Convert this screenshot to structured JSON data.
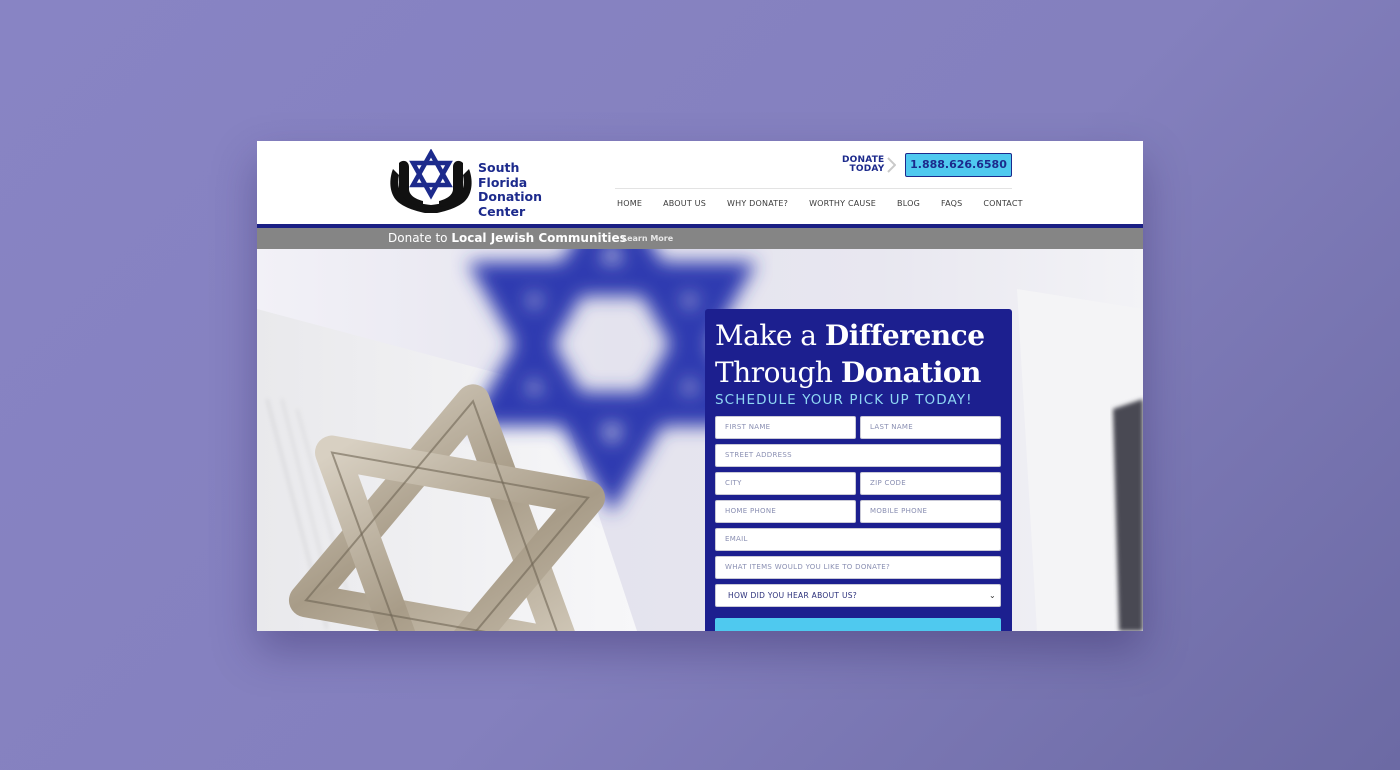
{
  "header": {
    "logo_lines": [
      "South",
      "Florida",
      "Donation",
      "Center"
    ],
    "donate_today_line1": "DONATE",
    "donate_today_line2": "TODAY",
    "phone": "1.888.626.6580",
    "nav": [
      "HOME",
      "ABOUT US",
      "WHY DONATE?",
      "WORTHY CAUSE",
      "BLOG",
      "FAQS",
      "CONTACT"
    ]
  },
  "ribbon": {
    "text_prefix": "Donate to ",
    "text_bold": "Local Jewish Communities",
    "link": "Learn More"
  },
  "form": {
    "heading_line1_a": "Make a ",
    "heading_line1_b": "Difference",
    "heading_line2_a": "Through ",
    "heading_line2_b": "Donation",
    "subheading": "SCHEDULE YOUR PICK UP TODAY!",
    "placeholders": {
      "first_name": "FIRST NAME",
      "last_name": "LAST NAME",
      "street": "STREET ADDRESS",
      "city": "CITY",
      "zip": "ZIP CODE",
      "home_phone": "HOME PHONE",
      "mobile_phone": "MOBILE PHONE",
      "email": "EMAIL",
      "items": "WHAT ITEMS WOULD YOU LIKE TO DONATE?"
    },
    "select_value": "HOW DID YOU HEAR ABOUT US?"
  },
  "colors": {
    "brand_navy": "#1c2a8c",
    "accent_cyan": "#4fc9ef",
    "card_blue": "#1c1f8f",
    "ribbon_gray": "#858585"
  }
}
